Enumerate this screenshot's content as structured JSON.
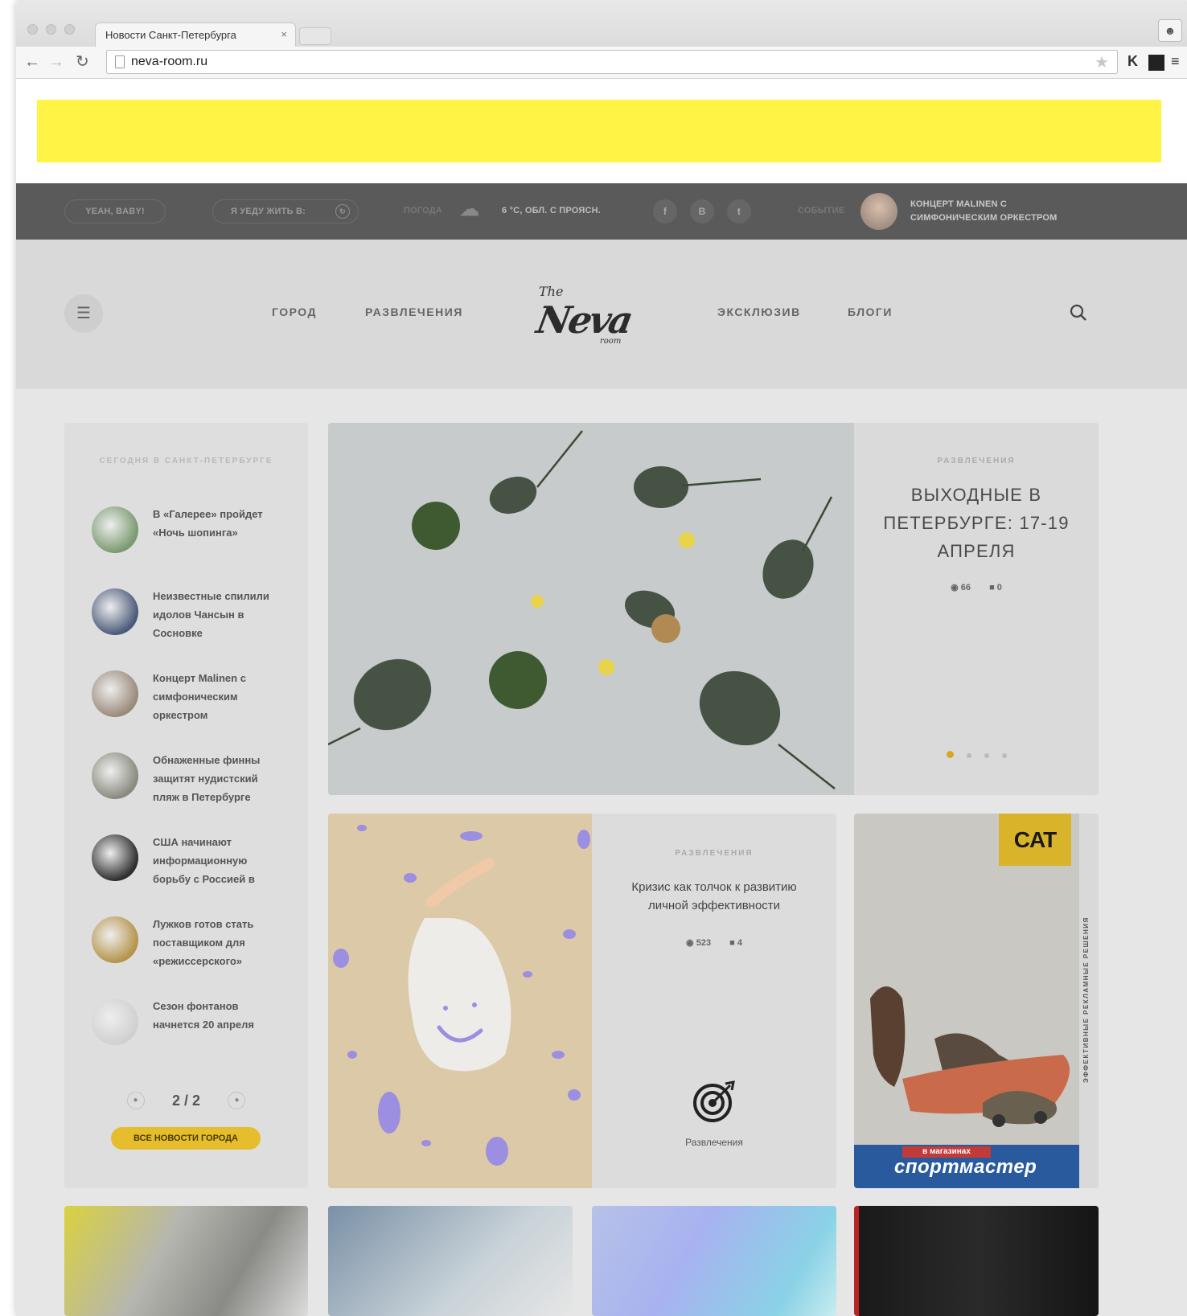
{
  "browser": {
    "tab_title": "Новости Санкт-Петербурга",
    "tab_close": "×",
    "url": "neva-room.ru"
  },
  "topbar": {
    "pill1": "YEAH, BABY!",
    "pill2": "Я УЕДУ ЖИТЬ В:",
    "weather_label": "ПОГОДА",
    "weather_value": "6 °С, ОБЛ. С ПРОЯСН.",
    "social": [
      "f",
      "В",
      "t"
    ],
    "event_label": "СОБЫТИЕ",
    "event_text": "КОНЦЕРТ MALINEN С СИМФОНИЧЕСКИМ ОРКЕСТРОМ"
  },
  "nav": {
    "links_left": [
      "ГОРОД",
      "РАЗВЛЕЧЕНИЯ"
    ],
    "links_right": [
      "ЭКСКЛЮЗИВ",
      "БЛОГИ"
    ],
    "logo_the": "The",
    "logo_neva": "Neva",
    "logo_room": "room"
  },
  "city_news": {
    "title": "СЕГОДНЯ В САНКТ-ПЕТЕРБУРГЕ",
    "items": [
      {
        "text": "В «Галерее» пройдет «Ночь шопинга»",
        "color": "#7a9a70"
      },
      {
        "text": "Неизвестные спилили идолов Чансын в Сосновке",
        "color": "#4b5a7a"
      },
      {
        "text": "Концерт Malinen с симфоническим оркестром",
        "color": "#9a8a7a"
      },
      {
        "text": "Обнаженные финны защитят нудистский пляж в Петербурге",
        "color": "#8a8a80"
      },
      {
        "text": "США начинают информационную борьбу с Россией в",
        "color": "#2e2e2e"
      },
      {
        "text": "Лужков готов стать поставщиком для «режиссерского»",
        "color": "#b5944a"
      },
      {
        "text": "Сезон фонтанов начнется 20 апреля",
        "color": "#d0d0d0"
      }
    ],
    "page": "2 / 2",
    "all_news": "ВСЕ НОВОСТИ ГОРОДА"
  },
  "hero": {
    "category": "РАЗВЛЕЧЕНИЯ",
    "title": "ВЫХОДНЫЕ В ПЕТЕРБУРГЕ: 17-19 АПРЕЛЯ",
    "views": "66",
    "comments": "0",
    "slides": 4,
    "active_slide": 1
  },
  "card2": {
    "category": "РАЗВЛЕЧЕНИЯ",
    "title": "Кризис как толчок к развитию личной эффективности",
    "views": "523",
    "comments": "4",
    "rubric": "Развлечения"
  },
  "ad": {
    "brand": "CAT",
    "store_small": "в магазинах",
    "store": "спортмастер",
    "vertical": "ЭФФЕКТИВНЫЕ РЕКЛАМНЫЕ РЕШЕНИЯ"
  },
  "colors": {
    "accent_yellow": "#fff346",
    "button_yellow": "#e6bd2c",
    "topbar": "#5a5a5a"
  }
}
